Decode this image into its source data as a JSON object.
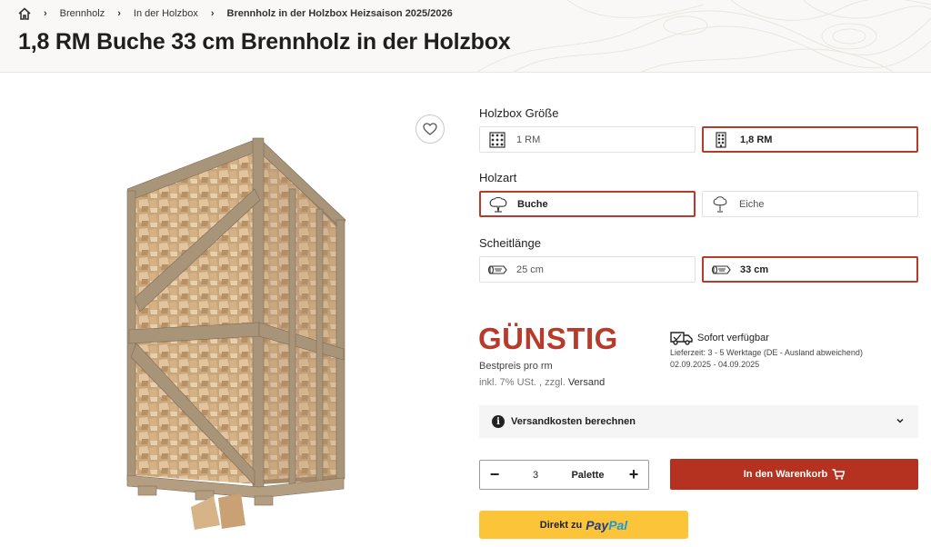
{
  "breadcrumb": {
    "items": [
      "Brennholz",
      "In der Holzbox",
      "Brennholz in der Holzbox Heizsaison 2025/2026"
    ]
  },
  "product": {
    "title": "1,8 RM Buche 33 cm Brennholz in der Holzbox"
  },
  "options": {
    "size": {
      "label": "Holzbox Größe",
      "choices": [
        {
          "label": "1 RM",
          "icon": "stacked-wood-grid-icon",
          "selected": false
        },
        {
          "label": "1,8 RM",
          "icon": "tall-wood-stack-icon",
          "selected": true
        }
      ]
    },
    "wood": {
      "label": "Holzart",
      "choices": [
        {
          "label": "Buche",
          "icon": "beech-tree-icon",
          "selected": true
        },
        {
          "label": "Eiche",
          "icon": "oak-tree-icon",
          "selected": false
        }
      ]
    },
    "length": {
      "label": "Scheitlänge",
      "choices": [
        {
          "label": "25 cm",
          "icon": "log-icon",
          "selected": false
        },
        {
          "label": "33 cm",
          "icon": "log-icon",
          "selected": true
        }
      ]
    }
  },
  "price": {
    "headline": "GÜNSTIG",
    "subline": "Bestpreis pro rm",
    "tax_prefix": "inkl. 7% USt. , zzgl.",
    "shipping_link": "Versand"
  },
  "delivery": {
    "status": "Sofort verfügbar",
    "time": "Lieferzeit: 3 - 5 Werktage (DE - Ausland abweichend)",
    "range": "02.09.2025 - 04.09.2025"
  },
  "shipping_calc": {
    "label": "Versandkosten berechnen",
    "info_glyph": "i"
  },
  "quantity": {
    "value": "3",
    "unit": "Palette",
    "minus": "−",
    "plus": "+"
  },
  "cart": {
    "label": "In den Warenkorb"
  },
  "paypal": {
    "prefix": "Direkt zu",
    "brand_1": "Pay",
    "brand_2": "Pal"
  },
  "colors": {
    "accent": "#b83a2a",
    "paypal_yellow": "#fcc439"
  }
}
